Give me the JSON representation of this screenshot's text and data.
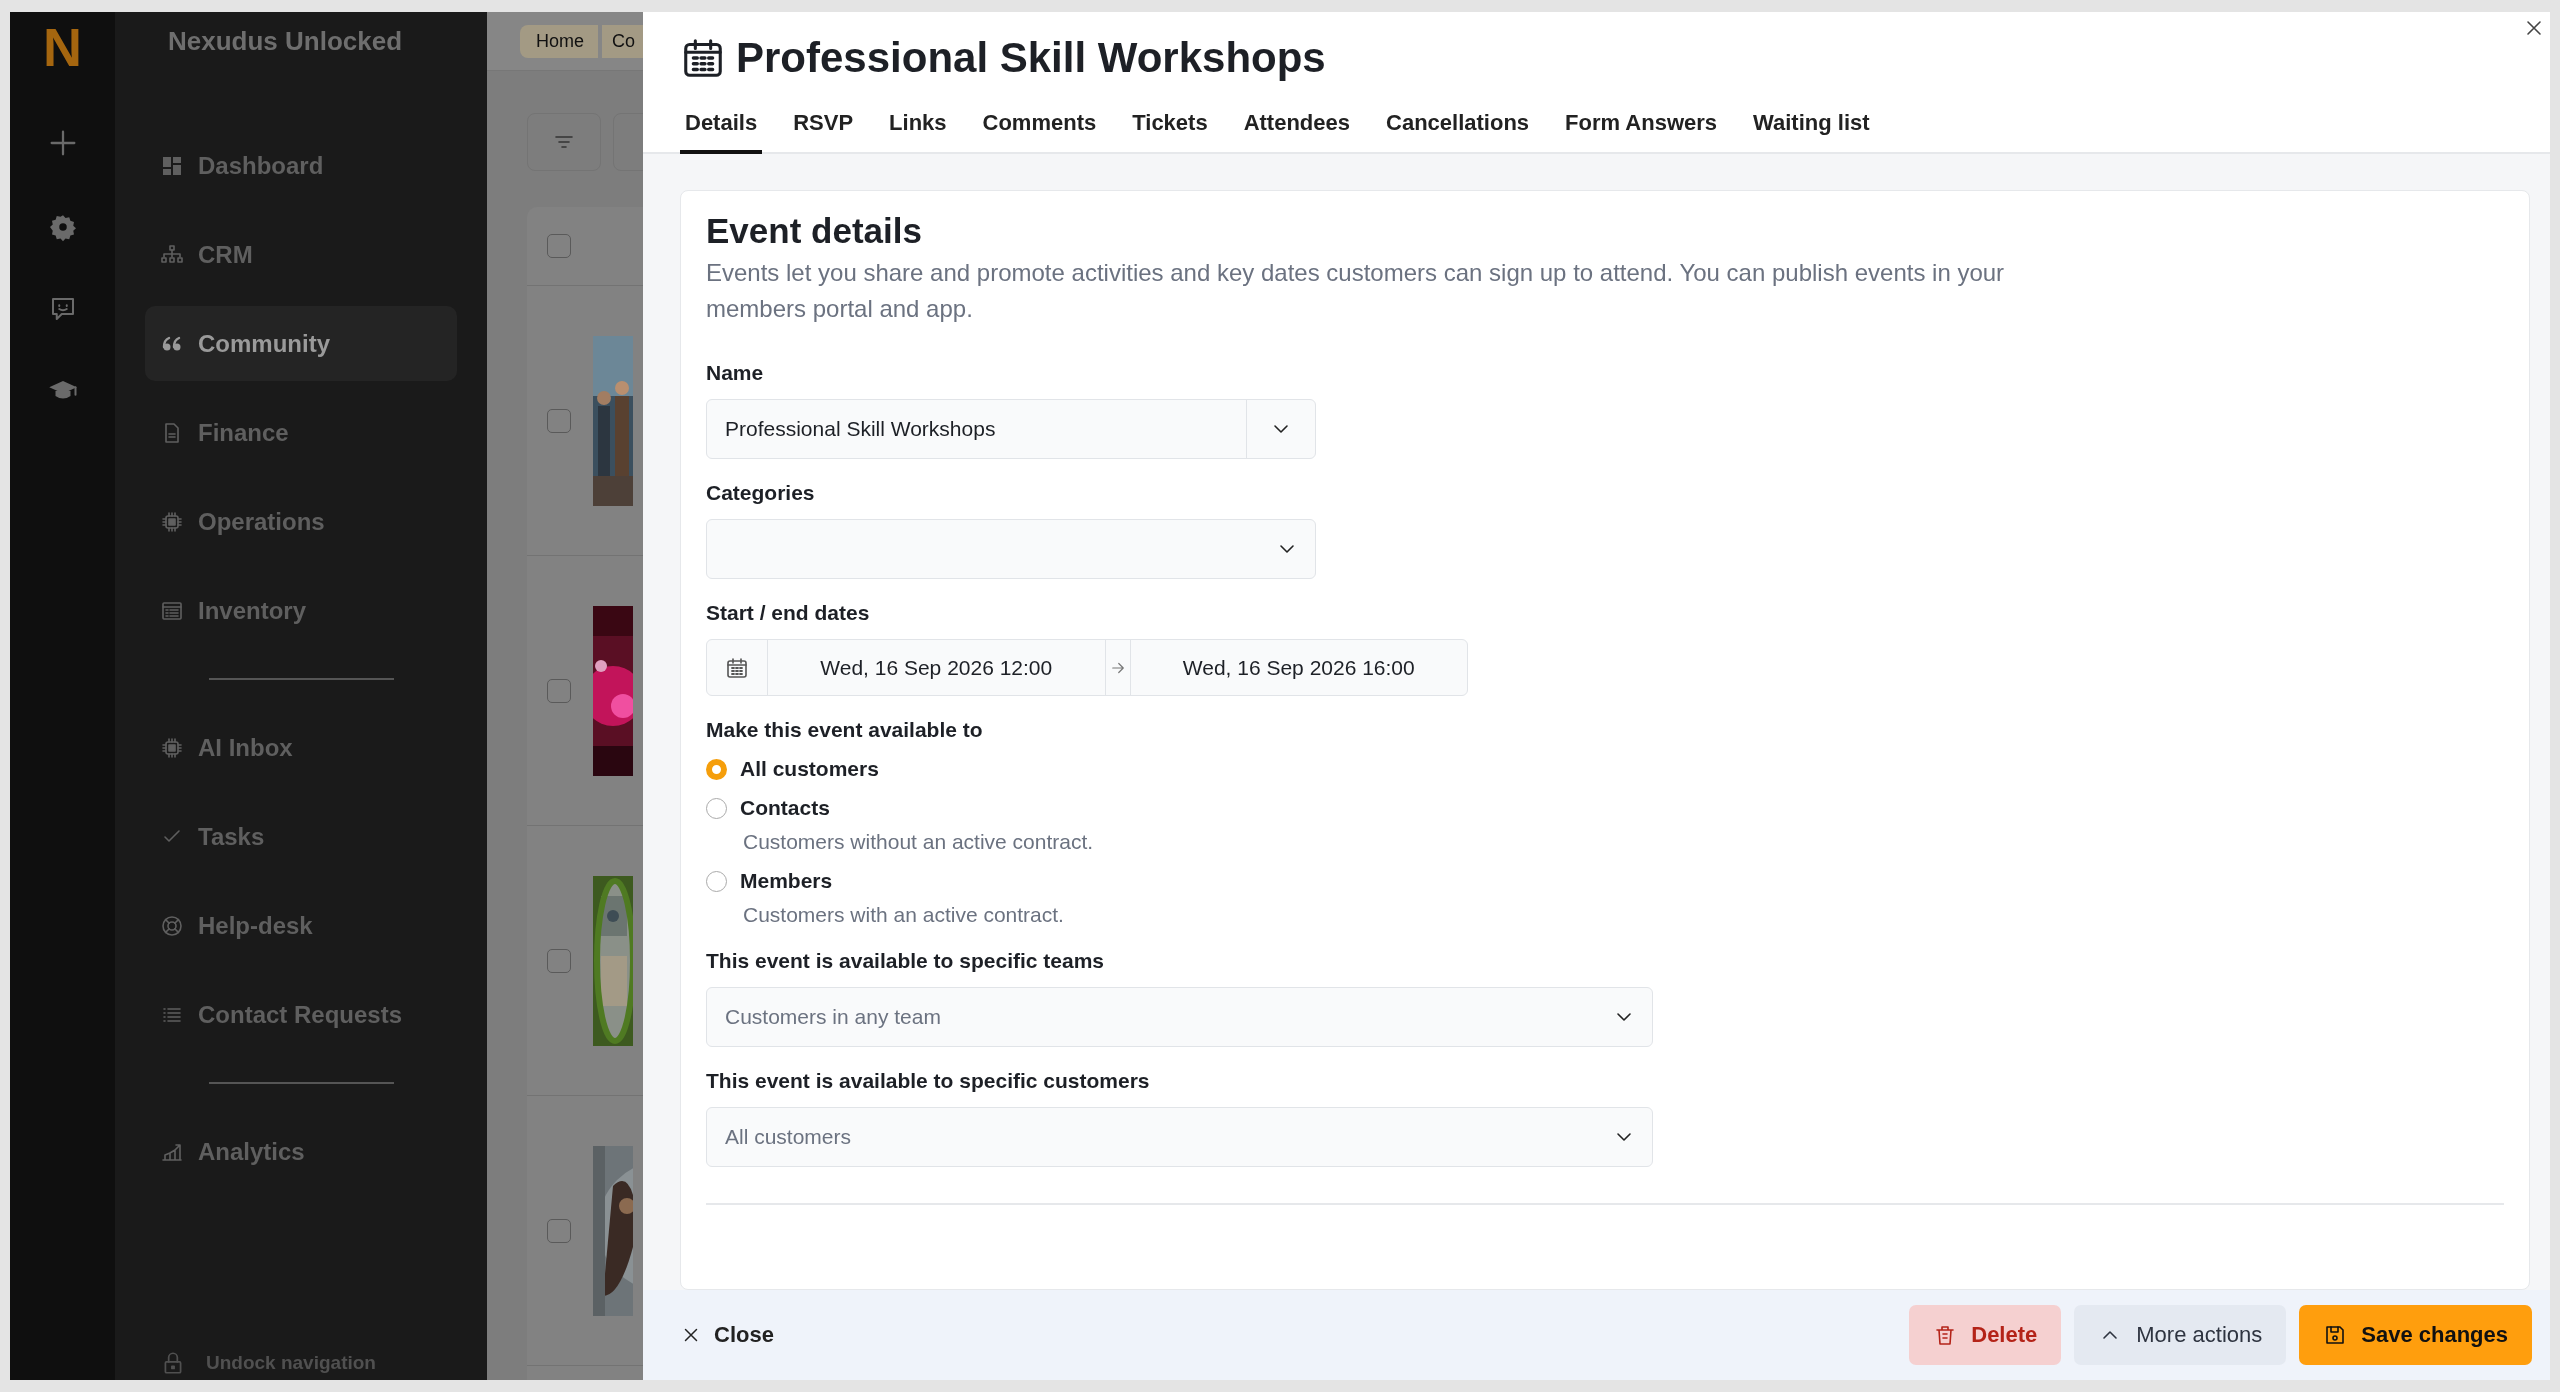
{
  "rail": {
    "logo": "N"
  },
  "sidebar": {
    "title": "Nexudus Unlocked",
    "groups": [
      {
        "items": [
          {
            "label": "Dashboard",
            "selected": false
          },
          {
            "label": "CRM",
            "selected": false
          },
          {
            "label": "Community",
            "selected": true
          },
          {
            "label": "Finance",
            "selected": false
          },
          {
            "label": "Operations",
            "selected": false
          },
          {
            "label": "Inventory",
            "selected": false
          }
        ]
      },
      {
        "items": [
          {
            "label": "AI Inbox",
            "selected": false
          },
          {
            "label": "Tasks",
            "selected": false
          },
          {
            "label": "Help-desk",
            "selected": false
          },
          {
            "label": "Contact Requests",
            "selected": false
          }
        ]
      },
      {
        "items": [
          {
            "label": "Analytics",
            "selected": false
          }
        ]
      }
    ],
    "footer": "Undock navigation"
  },
  "background": {
    "breadcrumbs": [
      "Home",
      "Co"
    ],
    "select_all": {
      "checked": false
    },
    "rows": [
      {
        "checked": false,
        "kind": "picture"
      },
      {
        "checked": false,
        "kind": "picture"
      },
      {
        "checked": false,
        "kind": "picture"
      },
      {
        "checked": false,
        "kind": "picture"
      }
    ]
  },
  "modal": {
    "title": "Professional Skill Workshops",
    "tabs": [
      {
        "label": "Details",
        "selected": true
      },
      {
        "label": "RSVP",
        "selected": false
      },
      {
        "label": "Links",
        "selected": false
      },
      {
        "label": "Comments",
        "selected": false
      },
      {
        "label": "Tickets",
        "selected": false
      },
      {
        "label": "Attendees",
        "selected": false
      },
      {
        "label": "Cancellations",
        "selected": false
      },
      {
        "label": "Form Answers",
        "selected": false
      },
      {
        "label": "Waiting list",
        "selected": false
      }
    ],
    "card": {
      "heading": "Event details",
      "description": "Events let you share and promote activities and key dates customers can sign up to attend. You can publish events in your members portal and app."
    },
    "form": {
      "name": {
        "label": "Name",
        "value": "Professional Skill Workshops"
      },
      "categories": {
        "label": "Categories"
      },
      "dates": {
        "label": "Start / end dates",
        "start": "Wed, 16 Sep 2026 12:00",
        "end": "Wed, 16 Sep 2026 16:00"
      },
      "availability": {
        "label": "Make this event available to",
        "options": [
          {
            "label": "All customers",
            "selected": true
          },
          {
            "label": "Contacts",
            "description": "Customers without an active contract.",
            "selected": false
          },
          {
            "label": "Members",
            "description": "Customers with an active contract.",
            "selected": false
          }
        ]
      },
      "teams": {
        "label": "This event is available to specific teams",
        "value": "Customers in any team"
      },
      "customers": {
        "label": "This event is available to specific customers",
        "value": "All customers"
      }
    },
    "footer": {
      "close": "Close",
      "buttons": [
        {
          "label": "Delete",
          "kind": "danger"
        },
        {
          "label": "More actions",
          "kind": "secondary"
        },
        {
          "label": "Save changes",
          "kind": "primary"
        }
      ]
    }
  }
}
